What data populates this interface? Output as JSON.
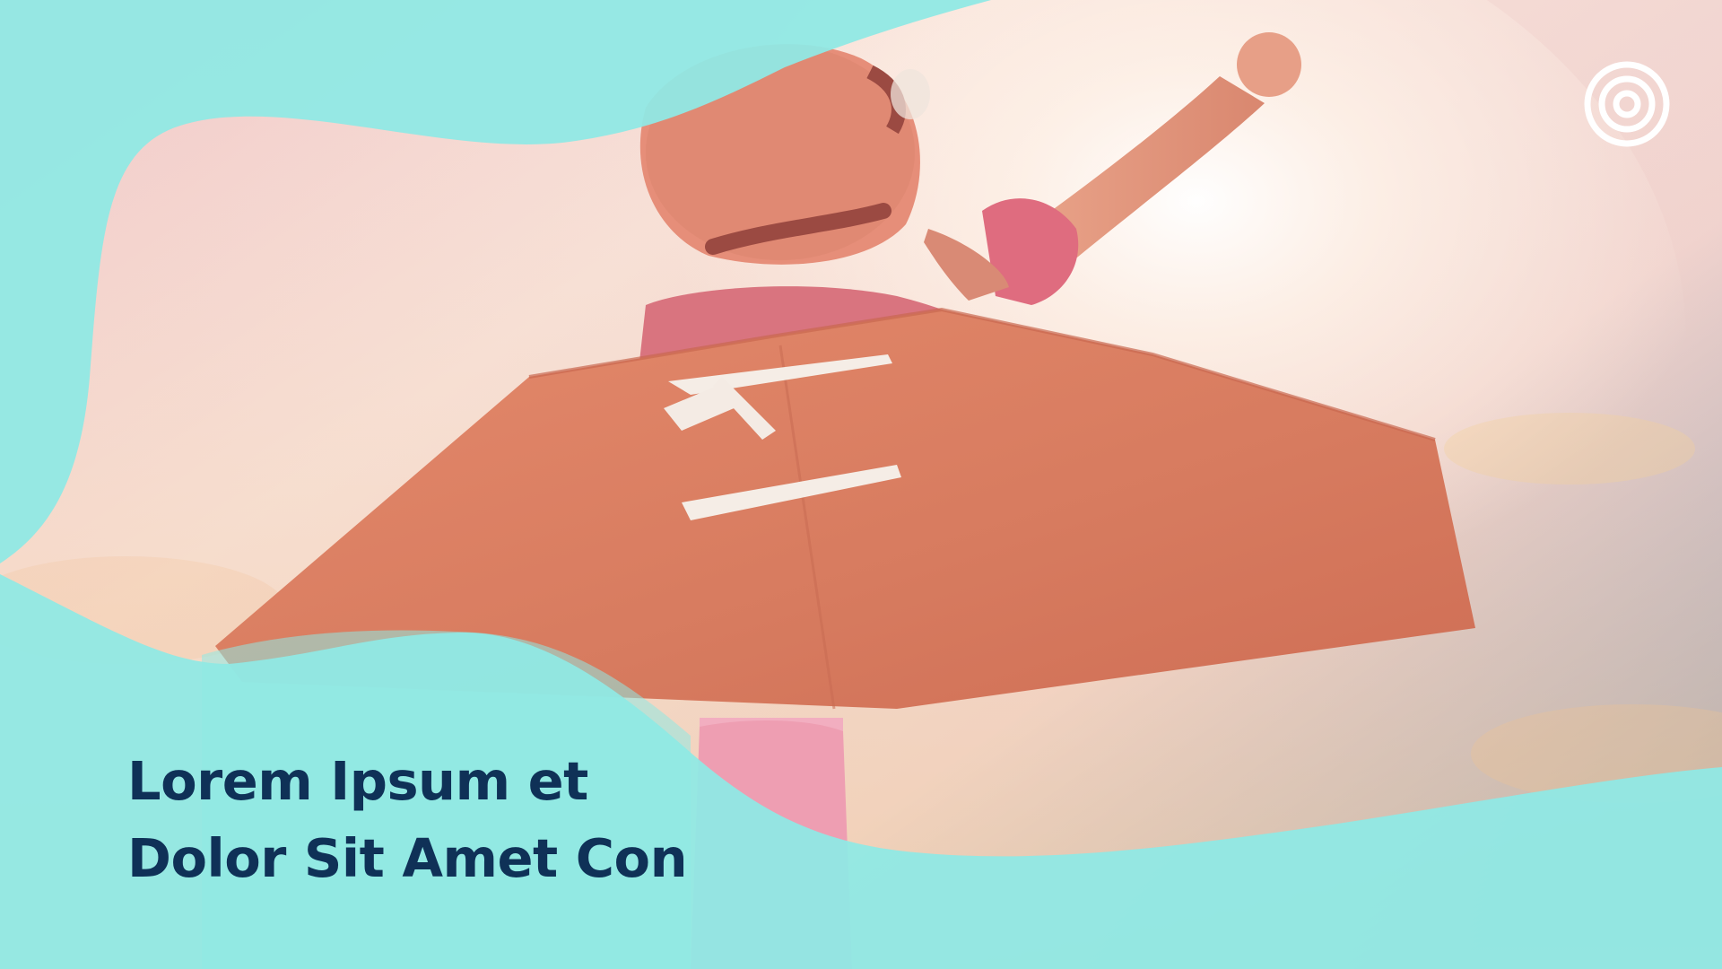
{
  "title": {
    "line1": "Lorem Ipsum et",
    "line2": "Dolor Sit Amet Con"
  },
  "photo": {
    "subject": "child in cardboard airplane wings costume against sunset sky"
  },
  "logo": {
    "icon": "concentric-circles-icon"
  },
  "colors": {
    "overlay_mint": "#8fe9e4",
    "title_navy": "#0f3157",
    "logo_white": "#ffffff"
  }
}
